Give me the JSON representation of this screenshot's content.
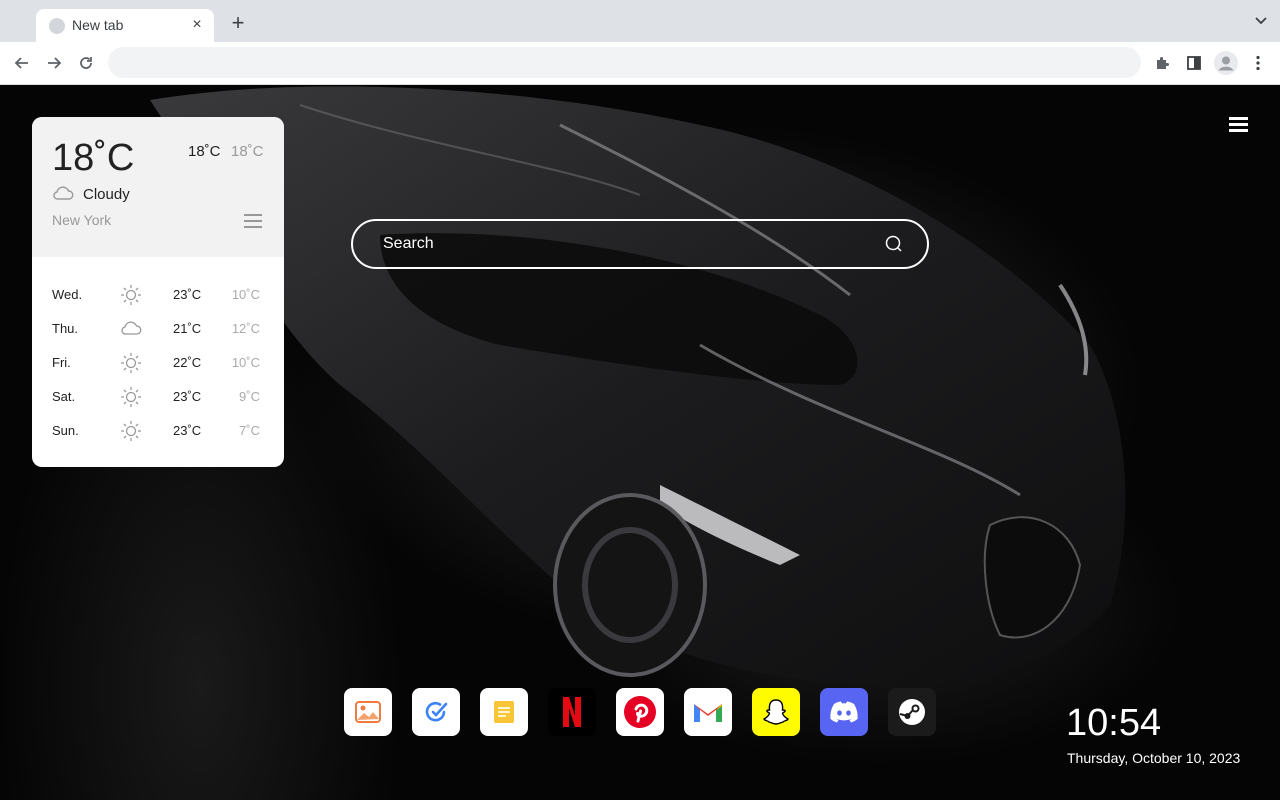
{
  "browser": {
    "tab": {
      "title": "New tab"
    },
    "omnibox": {
      "value": "",
      "placeholder": ""
    }
  },
  "weather": {
    "current_temp": "18˚C",
    "high": "18˚C",
    "low": "18˚C",
    "condition": "Cloudy",
    "condition_icon": "cloud-icon",
    "city": "New York",
    "forecast": [
      {
        "day": "Wed.",
        "icon": "sun-icon",
        "high": "23˚C",
        "low": "10˚C"
      },
      {
        "day": "Thu.",
        "icon": "cloud-icon",
        "high": "21˚C",
        "low": "12˚C"
      },
      {
        "day": "Fri.",
        "icon": "sun-icon",
        "high": "22˚C",
        "low": "10˚C"
      },
      {
        "day": "Sat.",
        "icon": "sun-icon",
        "high": "23˚C",
        "low": "9˚C"
      },
      {
        "day": "Sun.",
        "icon": "sun-icon",
        "high": "23˚C",
        "low": "7˚C"
      }
    ]
  },
  "search": {
    "placeholder": "Search"
  },
  "dock": {
    "apps": [
      {
        "name": "photos",
        "icon": "image-icon",
        "bg": "#ffffff"
      },
      {
        "name": "todo",
        "icon": "check-pen-icon",
        "bg": "#ffffff"
      },
      {
        "name": "notes",
        "icon": "note-icon",
        "bg": "#ffffff"
      },
      {
        "name": "netflix",
        "icon": "netflix-icon",
        "bg": "#000000"
      },
      {
        "name": "pinterest",
        "icon": "pinterest-icon",
        "bg": "#ffffff"
      },
      {
        "name": "gmail",
        "icon": "gmail-icon",
        "bg": "#ffffff"
      },
      {
        "name": "snapchat",
        "icon": "snapchat-icon",
        "bg": "#fffc00"
      },
      {
        "name": "discord",
        "icon": "discord-icon",
        "bg": "#5865f2"
      },
      {
        "name": "steam",
        "icon": "steam-icon",
        "bg": "#1b1b1b"
      }
    ]
  },
  "clock": {
    "time": "10:54",
    "date": "Thursday, October 10, 2023"
  },
  "colors": {
    "netflix": "#e50914",
    "pinterest": "#e60023",
    "gmail_red": "#ea4335",
    "discord": "#5865f2",
    "snapchat": "#fffc00",
    "notes": "#f9c535",
    "todo": "#3b82f6"
  }
}
